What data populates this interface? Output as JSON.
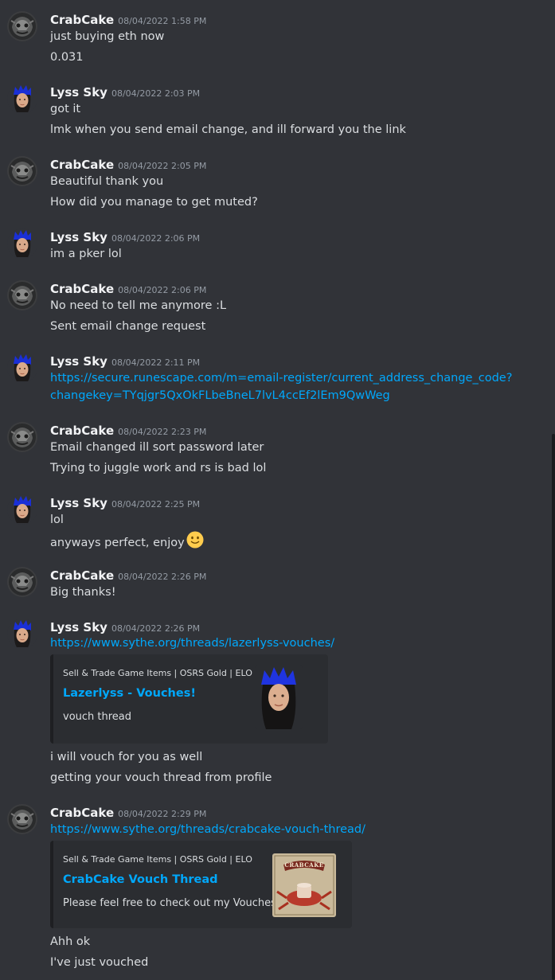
{
  "messages": [
    {
      "author": "CrabCake",
      "avatar": "crabcake-avatar",
      "timestamp": "08/04/2022 1:58 PM",
      "lines": [
        "just buying eth now",
        "0.031"
      ]
    },
    {
      "author": "Lyss Sky",
      "avatar": "lyss-avatar",
      "timestamp": "08/04/2022 2:03 PM",
      "lines": [
        "got it",
        "lmk when you send email change, and ill forward you the link"
      ]
    },
    {
      "author": "CrabCake",
      "avatar": "crabcake-avatar",
      "timestamp": "08/04/2022 2:05 PM",
      "lines": [
        "Beautiful thank you",
        "How did you manage to get muted?"
      ]
    },
    {
      "author": "Lyss Sky",
      "avatar": "lyss-avatar",
      "timestamp": "08/04/2022 2:06 PM",
      "lines": [
        "im a pker lol"
      ]
    },
    {
      "author": "CrabCake",
      "avatar": "crabcake-avatar",
      "timestamp": "08/04/2022 2:06 PM",
      "lines": [
        "No need to tell me anymore :L",
        "Sent email change request"
      ]
    },
    {
      "author": "Lyss Sky",
      "avatar": "lyss-avatar",
      "timestamp": "08/04/2022 2:11 PM",
      "link_lines": [
        "https://secure.runescape.com/m=email-register/current_address_change_code?",
        "changekey=TYqjgr5QxOkFLbeBneL7lvL4ccEf2lEm9QwWeg"
      ]
    },
    {
      "author": "CrabCake",
      "avatar": "crabcake-avatar",
      "timestamp": "08/04/2022 2:23 PM",
      "lines": [
        "Email changed ill sort password later",
        "Trying to juggle work and rs is bad lol"
      ]
    },
    {
      "author": "Lyss Sky",
      "avatar": "lyss-avatar",
      "timestamp": "08/04/2022 2:25 PM",
      "lines": [
        "lol",
        "anyways perfect, enjoy"
      ],
      "emoji": "slightly-smiling-face-emoji"
    },
    {
      "author": "CrabCake",
      "avatar": "crabcake-avatar",
      "timestamp": "08/04/2022 2:26 PM",
      "lines": [
        "Big thanks!"
      ]
    },
    {
      "author": "Lyss Sky",
      "avatar": "lyss-avatar",
      "timestamp": "08/04/2022 2:26 PM",
      "link": "https://www.sythe.org/threads/lazerlyss-vouches/",
      "embed": {
        "provider": "Sell & Trade Game Items | OSRS Gold | ELO",
        "title": "Lazerlyss - Vouches!",
        "description": "vouch thread",
        "thumbnail": "lyss-character-thumbnail"
      },
      "lines": [
        "i will vouch for you as well",
        "getting your vouch thread from profile"
      ]
    },
    {
      "author": "CrabCake",
      "avatar": "crabcake-avatar",
      "timestamp": "08/04/2022 2:29 PM",
      "link": "https://www.sythe.org/threads/crabcake-vouch-thread/",
      "embed": {
        "provider": "Sell & Trade Game Items | OSRS Gold | ELO",
        "title": "CrabCake Vouch Thread",
        "description": "Please feel free to check out my Vouches!",
        "thumbnail": "crabcake-thumbnail",
        "thumbnail_text": "CRABCAKE"
      },
      "lines": [
        "Ahh ok",
        "I've just vouched"
      ]
    }
  ],
  "colors": {
    "background": "#313338",
    "embed_background": "#2b2d31",
    "link": "#00a8fc",
    "author": "#f2f3f5",
    "timestamp": "#949ba4",
    "text": "#dbdee1"
  }
}
